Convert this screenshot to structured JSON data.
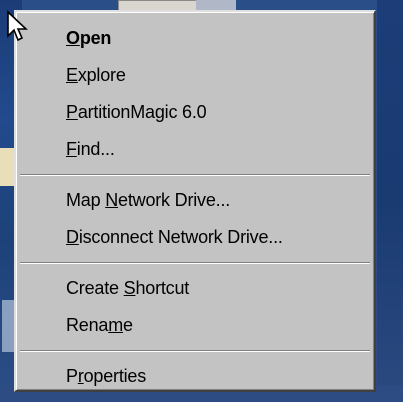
{
  "menu": {
    "items": [
      {
        "pre": "",
        "key": "O",
        "post": "pen",
        "bold": true
      },
      {
        "pre": "",
        "key": "E",
        "post": "xplore",
        "bold": false
      },
      {
        "pre": "",
        "key": "P",
        "post": "artitionMagic 6.0",
        "bold": false
      },
      {
        "pre": "",
        "key": "F",
        "post": "ind...",
        "bold": false
      },
      {
        "pre": "Map ",
        "key": "N",
        "post": "etwork Drive...",
        "bold": false
      },
      {
        "pre": "",
        "key": "D",
        "post": "isconnect Network Drive...",
        "bold": false
      },
      {
        "pre": "Create ",
        "key": "S",
        "post": "hortcut",
        "bold": false
      },
      {
        "pre": "Rena",
        "key": "m",
        "post": "e",
        "bold": false
      },
      {
        "pre": "P",
        "key": "r",
        "post": "operties",
        "bold": false
      }
    ]
  },
  "icons": {
    "pointer": "mouse-pointer-icon"
  },
  "colors": {
    "menu_bg": "#c3c3c3",
    "desktop": "#2a4f88"
  }
}
